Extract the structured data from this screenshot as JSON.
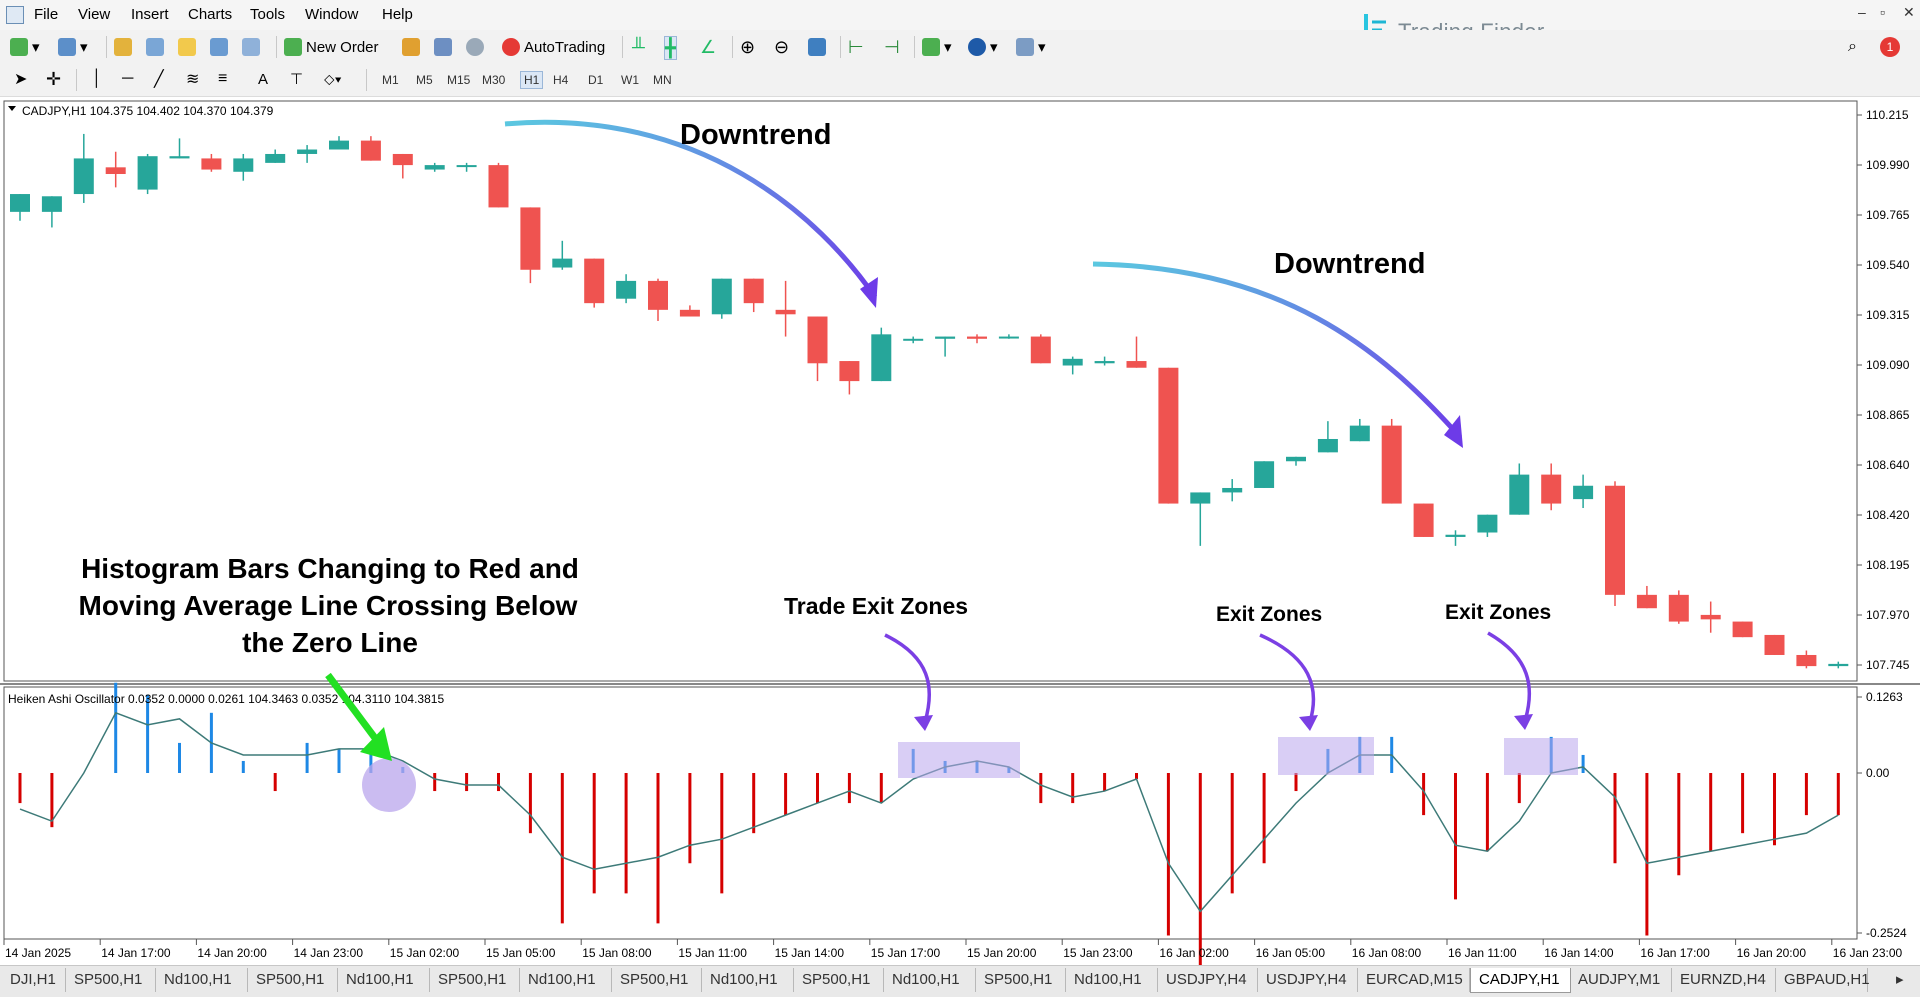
{
  "menu": {
    "items": [
      "File",
      "View",
      "Insert",
      "Charts",
      "Tools",
      "Window",
      "Help"
    ]
  },
  "toolbar": {
    "new_order": "New Order",
    "autotrading": "AutoTrading",
    "notification_count": "1"
  },
  "timeframes": [
    "M1",
    "M5",
    "M15",
    "M30",
    "H1",
    "H4",
    "D1",
    "W1",
    "MN"
  ],
  "logo": {
    "text": "Trading Finder"
  },
  "chart": {
    "main_header": "CADJPY,H1  104.375 104.402 104.370 104.379",
    "indicator_header": "Heiken Ashi Oscillator 0.0352 0.0000 0.0261 104.3463 0.0352 104.3110 104.3815",
    "price_labels": [
      "110.215",
      "109.990",
      "109.765",
      "109.540",
      "109.315",
      "109.090",
      "108.865",
      "108.640",
      "108.420",
      "108.195",
      "107.970",
      "107.745"
    ],
    "osc_labels": [
      "0.1263",
      "0.00",
      "-0.2524"
    ],
    "time_labels": [
      "14 Jan 2025",
      "14 Jan 17:00",
      "14 Jan 20:00",
      "14 Jan 23:00",
      "15 Jan 02:00",
      "15 Jan 05:00",
      "15 Jan 08:00",
      "15 Jan 11:00",
      "15 Jan 14:00",
      "15 Jan 17:00",
      "15 Jan 20:00",
      "15 Jan 23:00",
      "16 Jan 02:00",
      "16 Jan 05:00",
      "16 Jan 08:00",
      "16 Jan 11:00",
      "16 Jan 14:00",
      "16 Jan 17:00",
      "16 Jan 20:00",
      "16 Jan 23:00"
    ],
    "colors": {
      "bull": "#26a69a",
      "bear": "#ef5350",
      "hist_up": "#1e88e5",
      "hist_down": "#d50000",
      "ma": "#3d7a78"
    }
  },
  "annotations": {
    "downtrend1": "Downtrend",
    "downtrend2": "Downtrend",
    "histogram_note": [
      "Histogram Bars Changing to Red and",
      "Moving Average Line Crossing Below",
      "the Zero Line"
    ],
    "trade_exit": "Trade Exit Zones",
    "exit1": "Exit Zones",
    "exit2": "Exit Zones"
  },
  "tabs": [
    "DJI,H1",
    "SP500,H1",
    "Nd100,H1",
    "SP500,H1",
    "Nd100,H1",
    "SP500,H1",
    "Nd100,H1",
    "SP500,H1",
    "Nd100,H1",
    "SP500,H1",
    "Nd100,H1",
    "SP500,H1",
    "Nd100,H1",
    "USDJPY,H4",
    "USDJPY,H4",
    "EURCAD,M15",
    "CADJPY,H1",
    "AUDJPY,M1",
    "EURNZD,H4",
    "GBPAUD,H1"
  ],
  "active_tab": "CADJPY,H1"
}
